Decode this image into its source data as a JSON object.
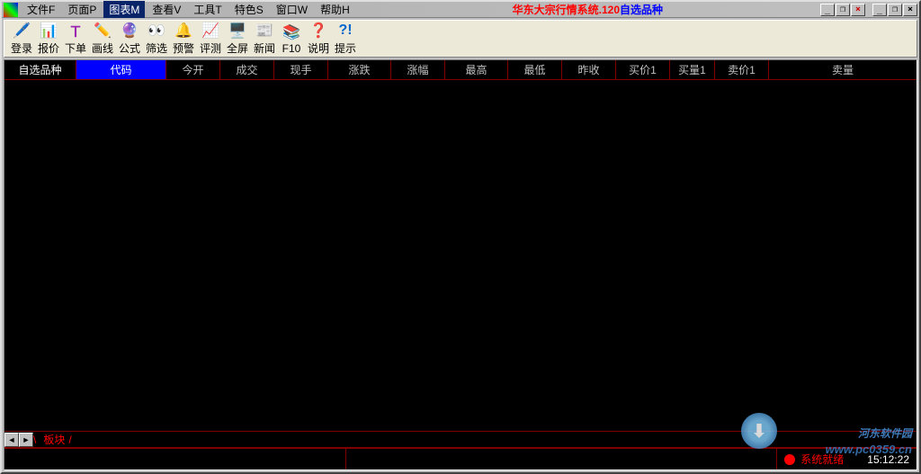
{
  "menubar": {
    "items": [
      {
        "label": "文件F"
      },
      {
        "label": "页面P"
      },
      {
        "label": "图表M",
        "active": true
      },
      {
        "label": "查看V"
      },
      {
        "label": "工具T"
      },
      {
        "label": "特色S"
      },
      {
        "label": "窗口W"
      },
      {
        "label": "帮助H"
      }
    ]
  },
  "title": {
    "red_part": "华东大宗行情系统.120",
    "blue_part": "自选品种"
  },
  "window_controls": {
    "minimize1": "_",
    "restore1": "❐",
    "close1": "×",
    "minimize2": "_",
    "restore2": "❐",
    "close2": "×"
  },
  "toolbar": {
    "items": [
      {
        "icon": "🖊️",
        "label": "登录",
        "color": "#e91e63"
      },
      {
        "icon": "📊",
        "label": "报价",
        "color": "#0066cc"
      },
      {
        "icon": "Ｔ",
        "label": "下单",
        "color": "#9c27b0"
      },
      {
        "icon": "✏️",
        "label": "画线",
        "color": "#ff9800"
      },
      {
        "icon": "🔮",
        "label": "公式",
        "color": "#9c27b0"
      },
      {
        "icon": "👀",
        "label": "筛选",
        "color": "#000"
      },
      {
        "icon": "🔔",
        "label": "预警",
        "color": "#ff5722"
      },
      {
        "icon": "📈",
        "label": "评测",
        "color": "#e91e63"
      },
      {
        "icon": "🖥️",
        "label": "全屏",
        "color": "#4caf50"
      },
      {
        "icon": "📰",
        "label": "新闻",
        "color": "#795548"
      },
      {
        "icon": "📚",
        "label": "F10",
        "color": "#8b4513"
      },
      {
        "icon": "❓",
        "label": "说明",
        "color": "#888"
      },
      {
        "icon": "?!",
        "label": "提示",
        "color": "#0066cc"
      }
    ]
  },
  "columns": [
    {
      "label": "自选品种",
      "class": "category"
    },
    {
      "label": "代码",
      "class": "code"
    },
    {
      "label": "今开",
      "class": "w60"
    },
    {
      "label": "成交",
      "class": "w60"
    },
    {
      "label": "现手",
      "class": "w60"
    },
    {
      "label": "涨跌",
      "class": "w70"
    },
    {
      "label": "涨幅",
      "class": "w60"
    },
    {
      "label": "最高",
      "class": "w70"
    },
    {
      "label": "最低",
      "class": "w60"
    },
    {
      "label": "昨收",
      "class": "w60"
    },
    {
      "label": "买价1",
      "class": "w60"
    },
    {
      "label": "买量1",
      "class": "w50"
    },
    {
      "label": "卖价1",
      "class": "w60"
    },
    {
      "label": "卖量",
      "class": "w50"
    }
  ],
  "tabs": {
    "sep_left": "\\",
    "label": "板块",
    "sep_right": "/"
  },
  "status": {
    "text": "系统就绪",
    "time": "15:12:22"
  },
  "watermark": {
    "text": "河东软件园",
    "url": "www.pc0359.cn"
  }
}
